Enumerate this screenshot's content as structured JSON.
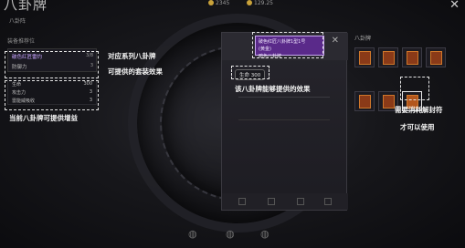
{
  "header": {
    "title": "八卦牌",
    "subtitle": "八卦阵",
    "resource_1": "2345",
    "resource_2": "129.25",
    "close_icon": "close-icon"
  },
  "left_panel": {
    "section_title": "装备推荐位",
    "set_items": [
      {
        "name": "破色红匠雷灼",
        "value": "3/8"
      },
      {
        "name": "防御力",
        "value": "3"
      }
    ],
    "stats": [
      {
        "name": "生命",
        "value": "300"
      },
      {
        "name": "攻击力",
        "value": "3"
      },
      {
        "name": "雷能威吸收",
        "value": "3"
      }
    ]
  },
  "card": {
    "title_line1": "破色红匠八卦牌1型1号",
    "title_line2": "(黄金)",
    "title_line3": "暗色八卦牌",
    "hp_label": "生命 300",
    "close_icon": "close-icon"
  },
  "right_panel": {
    "title": "八卦牌"
  },
  "annotations": {
    "set_effect_1": "对应系列八卦牌",
    "set_effect_2": "可提供的套装效果",
    "card_effect": "该八卦牌能够提供的效果",
    "slot_info": "当前八卦牌可提供增益",
    "unlock_1": "需要消耗解封符",
    "unlock_2": "才可以使用"
  },
  "colors": {
    "purple": "#5a2a8a",
    "item_orange": "#8a3a18",
    "dash": "#e5e5e5"
  }
}
